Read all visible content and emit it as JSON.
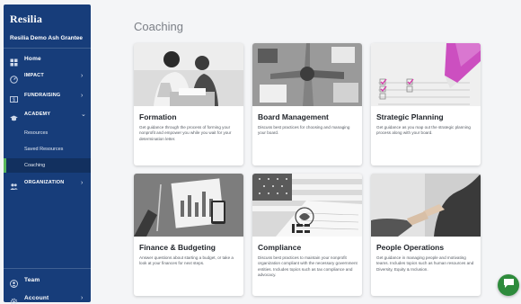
{
  "sidebar": {
    "brand": "Resilia",
    "org_name": "Resilia Demo Ash Grantee",
    "nav": {
      "home": "Home",
      "impact": "IMPACT",
      "fundraising": "FUNDRAISING",
      "academy": "ACADEMY",
      "organization": "ORGANIZATION"
    },
    "academy_items": [
      "Resources",
      "Saved Resources",
      "Coaching"
    ],
    "active_item": "Coaching",
    "footer": {
      "team": "Team",
      "account": "Account"
    }
  },
  "main": {
    "title": "Coaching",
    "cards": [
      {
        "title": "Formation",
        "desc": "Get guidance through the process of forming your nonprofit and empower you while you wait for your determination letter."
      },
      {
        "title": "Board Management",
        "desc": "Discuss best practices for choosing and managing your board."
      },
      {
        "title": "Strategic Planning",
        "desc": "Get guidance as you map out the strategic planning process along with your board."
      },
      {
        "title": "Finance & Budgeting",
        "desc": "Answer questions about starting a budget, or take a look at your finances for next steps."
      },
      {
        "title": "Compliance",
        "desc": "Discuss best practices to maintain your nonprofit organization compliant with the necessary government entities. Includes topics such as tax compliance and advocacy."
      },
      {
        "title": "People Operations",
        "desc": "Get guidance in managing people and motivating teams. Includes topics such as human resources and Diversity, Equity & Inclusion."
      }
    ]
  },
  "colors": {
    "sidebar": "#173d7a",
    "active_indicator": "#58b65b",
    "chat": "#2e8b3c"
  }
}
